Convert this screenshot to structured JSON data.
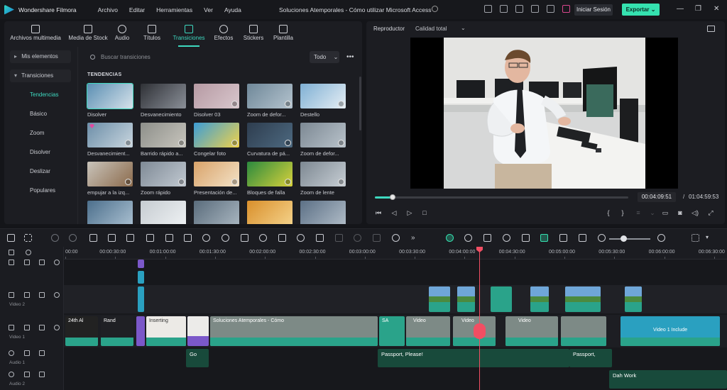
{
  "app": {
    "name": "Wondershare Filmora",
    "document_title": "Soluciones Atemporales - Cómo utilizar Microsoft Access",
    "login_label": "Iniciar Sesión",
    "export_label": "Exportar"
  },
  "menu": [
    "Archivo",
    "Editar",
    "Herramientas",
    "Ver",
    "Ayuda"
  ],
  "media_tabs": [
    {
      "label": "Archivos multimedia",
      "icon": "media-files-icon"
    },
    {
      "label": "Media de Stock",
      "icon": "stock-media-icon"
    },
    {
      "label": "Audio",
      "icon": "music-note-icon"
    },
    {
      "label": "Títulos",
      "icon": "text-t-icon"
    },
    {
      "label": "Transiciones",
      "icon": "transition-arrows-icon"
    },
    {
      "label": "Efectos",
      "icon": "sparkle-icon"
    },
    {
      "label": "Stickers",
      "icon": "sticker-icon"
    },
    {
      "label": "Plantilla",
      "icon": "template-icon"
    }
  ],
  "sidebar": {
    "groups": [
      {
        "label": "Mis elementos",
        "expanded": false
      },
      {
        "label": "Transiciones",
        "expanded": true
      }
    ],
    "items": [
      "Tendencias",
      "Básico",
      "Zoom",
      "Disolver",
      "Deslizar",
      "Populares"
    ],
    "active_item": "Tendencias"
  },
  "search": {
    "placeholder": "Buscar transiciones",
    "filter_label": "Todo"
  },
  "section_title": "TENDENCIAS",
  "transitions": [
    {
      "label": "Disolver",
      "selected": true,
      "premium": false,
      "download": false
    },
    {
      "label": "Desvanecimiento",
      "selected": false,
      "premium": false,
      "download": false
    },
    {
      "label": "Disolver 03",
      "selected": false,
      "premium": false,
      "download": true
    },
    {
      "label": "Zoom de defor...",
      "selected": false,
      "premium": false,
      "download": true
    },
    {
      "label": "Destello",
      "selected": false,
      "premium": false,
      "download": true
    },
    {
      "label": "Desvanecimient...",
      "selected": false,
      "premium": true,
      "download": true
    },
    {
      "label": "Barrido rápido a...",
      "selected": false,
      "premium": false,
      "download": true
    },
    {
      "label": "Congelar foto",
      "selected": false,
      "premium": false,
      "download": true
    },
    {
      "label": "Curvatura de pá...",
      "selected": false,
      "premium": false,
      "download": true
    },
    {
      "label": "Zoom de defor...",
      "selected": false,
      "premium": false,
      "download": true
    },
    {
      "label": "empujar a la izq...",
      "selected": false,
      "premium": false,
      "download": true
    },
    {
      "label": "Zoom rápido",
      "selected": false,
      "premium": false,
      "download": true
    },
    {
      "label": "Presentación de...",
      "selected": false,
      "premium": false,
      "download": true
    },
    {
      "label": "Bloques de falla",
      "selected": false,
      "premium": false,
      "download": true
    },
    {
      "label": "Zoom de lente",
      "selected": false,
      "premium": false,
      "download": true
    },
    {
      "label": "",
      "selected": false,
      "premium": false,
      "download": false
    },
    {
      "label": "",
      "selected": false,
      "premium": false,
      "download": false
    },
    {
      "label": "",
      "selected": false,
      "premium": false,
      "download": false
    },
    {
      "label": "",
      "selected": false,
      "premium": false,
      "download": false
    },
    {
      "label": "",
      "selected": false,
      "premium": false,
      "download": false
    }
  ],
  "player": {
    "tab_label": "Reproductor",
    "quality_label": "Calidad total",
    "current_time": "00:04:09:51",
    "separator": "/",
    "total_time": "01:04:59:53",
    "progress": 0.069
  },
  "timeline": {
    "ruler_labels": [
      "00:00",
      "00:00:30:00",
      "00:01:00:00",
      "00:01:30:00",
      "00:02:00:00",
      "00:02:30:00",
      "00:03:00:00",
      "00:03:30:00",
      "00:04:00:00",
      "00:04:30:00",
      "00:05:00:00",
      "00:05:30:00",
      "00:06:00:00",
      "00:06:30:00"
    ],
    "tracks": [
      {
        "id": "4",
        "name": ""
      },
      {
        "id": "2",
        "name": "Video 2"
      },
      {
        "id": "1",
        "name": "Video 1"
      },
      {
        "id": "1",
        "name": "Audio 1",
        "audio": true
      },
      {
        "id": "2",
        "name": "Audio 2",
        "audio": true
      }
    ],
    "clip_titles": {
      "v1_a": "24th Al",
      "v1_b": "Rand",
      "v1_c": "Inserting",
      "v1_d": "Soluciones Atemporales - Cómo",
      "v1_e": "SA",
      "v1_f": "Video",
      "v1_g": "Video",
      "v1_h": "Video",
      "v1_i": "Video 1 Include",
      "a1_a": "Passport, Please!",
      "a1_b": "Passport,",
      "a1_c": "Go",
      "a2_a": "Dah Work"
    }
  },
  "colors": {
    "accent": "#3ed9c0",
    "export": "#35e2b0",
    "playhead": "#f24e63",
    "audio_clip": "#184a3b",
    "video_clip_teal": "#2aa38a",
    "purple_clip": "#7b58c9"
  }
}
